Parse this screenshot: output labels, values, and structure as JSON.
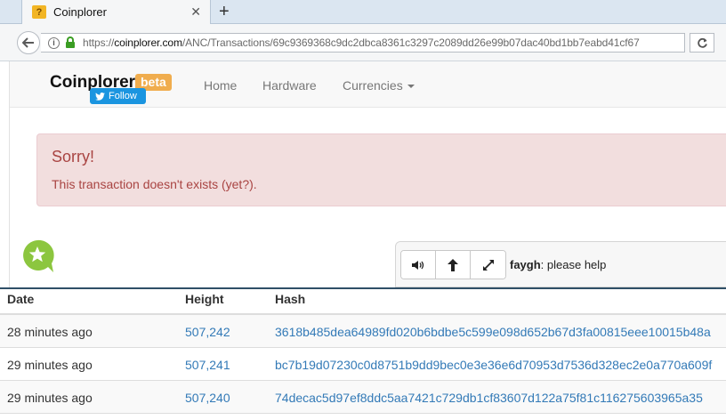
{
  "browser": {
    "tab_title": "Coinplorer",
    "favicon_glyph": "?",
    "url_prefix": "https://",
    "url_host": "coinplorer.com",
    "url_path": "/ANC/Transactions/69c9369368c9dc2dbca8361c3297c2089dd26e99b07dac40bd1bb7eabd41cf67",
    "new_tab_label": "+",
    "close_tab_label": "✕"
  },
  "site": {
    "brand": "Coinplorer",
    "beta_badge": "beta",
    "follow_label": "Follow",
    "nav": [
      "Home",
      "Hardware",
      "Currencies"
    ]
  },
  "alert": {
    "title": "Sorry!",
    "message": "This transaction doesn't exists (yet?)."
  },
  "chat": {
    "user": "faygh",
    "message": ": please help"
  },
  "table": {
    "headers": [
      "Date",
      "Height",
      "Hash"
    ],
    "rows": [
      {
        "date": "28 minutes ago",
        "height": "507,242",
        "hash": "3618b485dea64989fd020b6bdbe5c599e098d652b67d3fa00815eee10015b48a"
      },
      {
        "date": "29 minutes ago",
        "height": "507,241",
        "hash": "bc7b19d07230c0d8751b9dd9bec0e3e36e6d70953d7536d328ec2e0a770a609f"
      },
      {
        "date": "29 minutes ago",
        "height": "507,240",
        "hash": "74decac5d97ef8ddc5aa7421c729db1cf83607d122a75f81c116275603965a35"
      }
    ]
  },
  "colors": {
    "alert_bg": "#f2dede",
    "alert_text": "#a94442",
    "beta": "#f0ad4e",
    "link": "#337ab7",
    "twitter": "#1b95e0",
    "chat_icon": "#8cc63f"
  }
}
